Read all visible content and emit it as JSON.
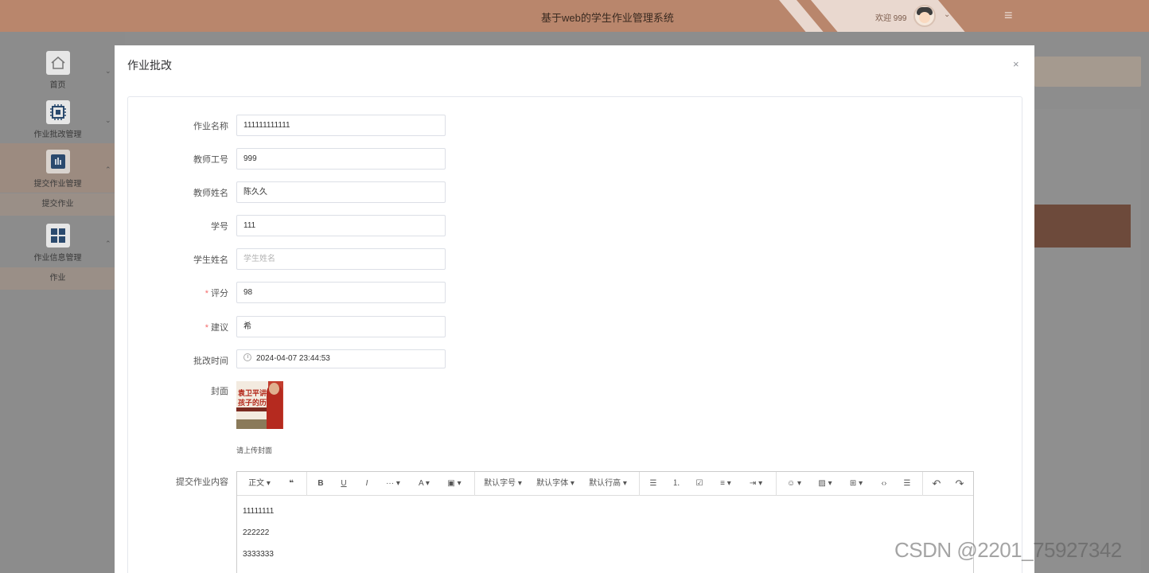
{
  "header": {
    "app_title": "基于web的学生作业管理系统",
    "welcome": "欢迎 999",
    "caret": "⌄",
    "menu_icon": "≡"
  },
  "sidebar": {
    "items": [
      {
        "label": "首页",
        "icon": "home-icon"
      },
      {
        "label": "作业批改管理",
        "icon": "chip-icon"
      },
      {
        "label": "提交作业管理",
        "icon": "bar-chart-icon"
      },
      {
        "label": "作业信息管理",
        "icon": "grid-icon"
      }
    ],
    "subitems": [
      "提交作业",
      "作业"
    ]
  },
  "modal": {
    "title": "作业批改",
    "close": "×"
  },
  "form": {
    "fields": [
      {
        "label": "作业名称",
        "value": "111111111111",
        "required": false
      },
      {
        "label": "教师工号",
        "value": "999",
        "required": false
      },
      {
        "label": "教师姓名",
        "value": "陈久久",
        "required": false
      },
      {
        "label": "学号",
        "value": "111",
        "required": false
      },
      {
        "label": "学生姓名",
        "placeholder": "学生姓名",
        "required": false
      },
      {
        "label": "评分",
        "value": "98",
        "required": true
      },
      {
        "label": "建议",
        "value": "希",
        "required": true
      },
      {
        "label": "批改时间",
        "value": "2024-04-07 23:44:53",
        "required": false
      }
    ],
    "required_mark": "*",
    "cover_label": "封面",
    "cover_text_1": "袁卫平讲给",
    "cover_text_2": "孩子的历史课",
    "cover_hint": "请上传封面",
    "content_label": "提交作业内容"
  },
  "editor": {
    "toolbar": {
      "paragraph": "正文 ▾",
      "quote": "❝",
      "bold": "B",
      "underline": "U",
      "italic": "I",
      "more": "··· ▾",
      "font_color": "A ▾",
      "bg_color": "▣ ▾",
      "font_size": "默认字号 ▾",
      "font_family": "默认字体 ▾",
      "line_height": "默认行高 ▾",
      "bullet_list": "☰",
      "numbered_list": "⒈",
      "todo": "☑",
      "align": "≡ ▾",
      "indent": "⇥ ▾",
      "emoji": "☺ ▾",
      "image": "▨ ▾",
      "table": "⊞ ▾",
      "code": "‹›",
      "divider": "☰",
      "undo": "↶",
      "redo": "↷"
    },
    "content": [
      "11111111",
      "222222",
      "3333333"
    ]
  },
  "watermark": "CSDN @2201_75927342"
}
